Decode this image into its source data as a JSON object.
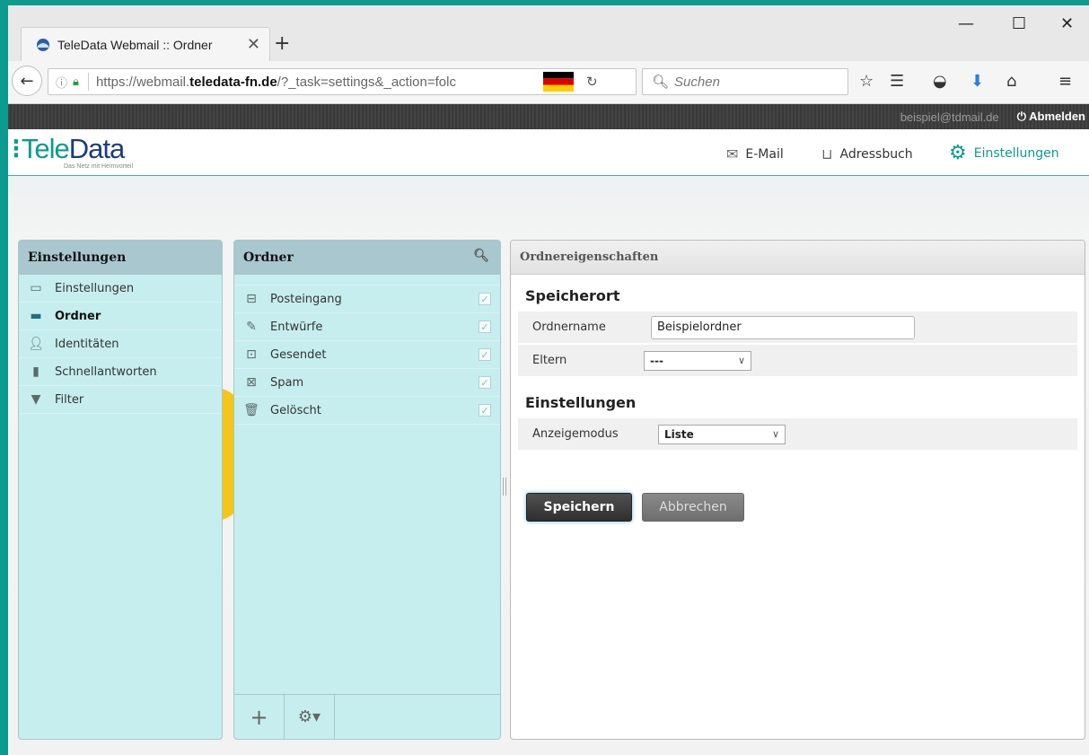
{
  "browser": {
    "tab_title": "TeleData Webmail :: Ordner",
    "tab_close": "✕",
    "new_tab": "+",
    "url_prefix": "https://webmail.",
    "url_domain": "teledata-fn.de",
    "url_path": "/?_task=settings&_action=folc",
    "search_placeholder": "Suchen",
    "window_min": "—",
    "window_max": "☐",
    "window_close": "✕"
  },
  "app": {
    "user_email": "beispiel@tdmail.de",
    "logout_label": "Abmelden",
    "logo_tele": "Tele",
    "logo_data": "Data",
    "logo_tagline": "Das Netz mit Heimvorteil",
    "nav": {
      "email": "E-Mail",
      "addressbook": "Adressbuch",
      "settings": "Einstellungen"
    },
    "accent_color": "#0c9b8e"
  },
  "settings_panel": {
    "title": "Einstellungen",
    "items": [
      {
        "label": "Einstellungen",
        "icon": "monitor-icon"
      },
      {
        "label": "Ordner",
        "icon": "folder-icon",
        "selected": true
      },
      {
        "label": "Identitäten",
        "icon": "user-icon"
      },
      {
        "label": "Schnellantworten",
        "icon": "document-icon"
      },
      {
        "label": "Filter",
        "icon": "funnel-icon"
      }
    ]
  },
  "folder_panel": {
    "title": "Ordner",
    "items": [
      {
        "label": "Posteingang",
        "icon": "inbox-icon"
      },
      {
        "label": "Entwürfe",
        "icon": "pencil-icon"
      },
      {
        "label": "Gesendet",
        "icon": "sent-icon"
      },
      {
        "label": "Spam",
        "icon": "spam-icon"
      },
      {
        "label": "Gelöscht",
        "icon": "trash-icon"
      }
    ],
    "footer_add": "+",
    "footer_settings": "⚙▾"
  },
  "properties": {
    "title": "Ordnereigenschaften",
    "section_location": "Speicherort",
    "folder_name_label": "Ordnername",
    "folder_name_value": "Beispielordner",
    "parent_label": "Eltern",
    "parent_value": "---",
    "section_settings": "Einstellungen",
    "display_mode_label": "Anzeigemodus",
    "display_mode_value": "Liste",
    "save_label": "Speichern",
    "cancel_label": "Abbrechen"
  }
}
